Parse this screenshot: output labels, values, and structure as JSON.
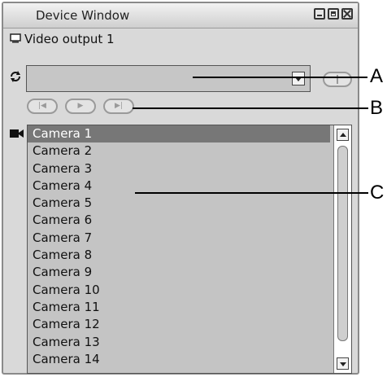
{
  "window": {
    "title": "Device Window"
  },
  "output": {
    "label": "Video output 1"
  },
  "cameras": [
    "Camera 1",
    "Camera 2",
    "Camera 3",
    "Camera 4",
    "Camera 5",
    "Camera 6",
    "Camera 7",
    "Camera 8",
    "Camera 9",
    "Camera 10",
    "Camera 11",
    "Camera 12",
    "Camera 13",
    "Camera 14"
  ],
  "selected_camera": "Camera 1",
  "callouts": [
    "A",
    "B",
    "C"
  ],
  "icons": {
    "output": "monitor-icon",
    "cycle": "cycle-icon",
    "camera": "camera-icon",
    "prev": "previous-icon",
    "play": "play-icon",
    "next": "next-icon"
  },
  "colors": {
    "selected_row_bg": "#777777",
    "list_bg": "#c4c4c4"
  }
}
